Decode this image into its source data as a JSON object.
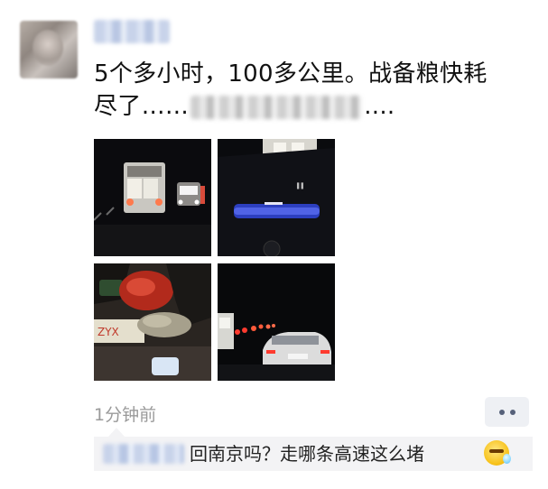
{
  "post": {
    "text_line1": "5个多小时，100多公里。战备粮快耗",
    "text_line2_prefix": "尽了……",
    "text_line2_suffix": "...."
  },
  "photos": [
    {
      "icon": "photo-night-ambulance"
    },
    {
      "icon": "photo-car-dashboard"
    },
    {
      "icon": "photo-snacks-in-car"
    },
    {
      "icon": "photo-traffic-jam"
    }
  ],
  "meta": {
    "timestamp": "1分钟前"
  },
  "comment": {
    "text": "回南京吗？走哪条高速这么堵",
    "emoji": "crying-laughing-emoji"
  },
  "colors": {
    "accent_blue": "#576b95",
    "comment_bg": "#f3f3f5",
    "more_button_bg": "#eef0f4"
  }
}
